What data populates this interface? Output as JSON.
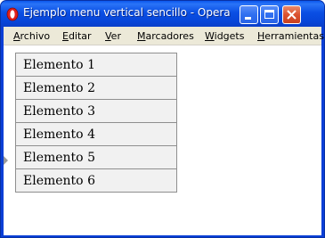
{
  "window": {
    "title": "Ejemplo menu vertical sencillo - Opera"
  },
  "menubar": {
    "items": [
      {
        "label": "Archivo",
        "accel": "A",
        "rest": "rchivo"
      },
      {
        "label": "Editar",
        "accel": "E",
        "rest": "ditar"
      },
      {
        "label": "Ver",
        "accel": "V",
        "rest": "er"
      },
      {
        "label": "Marcadores",
        "accel": "M",
        "rest": "arcadores"
      },
      {
        "label": "Widgets",
        "accel": "W",
        "rest": "idgets"
      },
      {
        "label": "Herramientas",
        "accel": "H",
        "rest": "erramientas"
      }
    ]
  },
  "vertical_menu": {
    "items": [
      {
        "label": "Elemento 1"
      },
      {
        "label": "Elemento 2"
      },
      {
        "label": "Elemento 3"
      },
      {
        "label": "Elemento 4"
      },
      {
        "label": "Elemento 5"
      },
      {
        "label": "Elemento 6"
      }
    ]
  },
  "colors": {
    "titlebar": "#0a4fe4",
    "menubar": "#ece9d8",
    "menu_item_bg": "#f1f1f1",
    "menu_item_border": "#8f8f8f",
    "close_button": "#db5230"
  }
}
